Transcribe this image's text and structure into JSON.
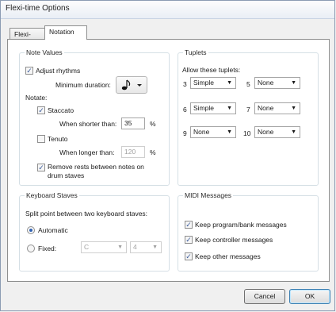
{
  "window": {
    "title": "Flexi-time Options"
  },
  "tabs": [
    {
      "label": "Flexi-time"
    },
    {
      "label": "Notation"
    }
  ],
  "note_values": {
    "title": "Note Values",
    "adjust_rhythms": {
      "label": "Adjust rhythms",
      "checked": true
    },
    "minimum_duration_label": "Minimum duration:",
    "minimum_duration_icon": "eighth-note-icon",
    "notate_label": "Notate:",
    "staccato": {
      "label": "Staccato",
      "checked": true
    },
    "staccato_shorter_label": "When shorter than:",
    "staccato_value": "35",
    "staccato_unit": "%",
    "tenuto": {
      "label": "Tenuto",
      "checked": false
    },
    "tenuto_longer_label": "When longer than:",
    "tenuto_value": "120",
    "tenuto_unit": "%",
    "remove_rests": {
      "label_line1": "Remove rests between notes on",
      "label_line2": "drum staves",
      "checked": true
    }
  },
  "tuplets": {
    "title": "Tuplets",
    "allow_label": "Allow these tuplets:",
    "items": [
      {
        "n": "3",
        "value": "Simple"
      },
      {
        "n": "5",
        "value": "None"
      },
      {
        "n": "6",
        "value": "Simple"
      },
      {
        "n": "7",
        "value": "None"
      },
      {
        "n": "9",
        "value": "None"
      },
      {
        "n": "10",
        "value": "None"
      }
    ]
  },
  "keyboard": {
    "title": "Keyboard Staves",
    "split_label": "Split point between two keyboard staves:",
    "automatic": {
      "label": "Automatic",
      "selected": true
    },
    "fixed": {
      "label": "Fixed:",
      "selected": false
    },
    "fixed_note": "C",
    "fixed_octave": "4"
  },
  "midi": {
    "title": "MIDI Messages",
    "program_bank": {
      "label": "Keep program/bank messages",
      "checked": true
    },
    "controller": {
      "label": "Keep controller messages",
      "checked": true
    },
    "other": {
      "label": "Keep other messages",
      "checked": true
    }
  },
  "buttons": {
    "cancel": "Cancel",
    "ok": "OK"
  }
}
